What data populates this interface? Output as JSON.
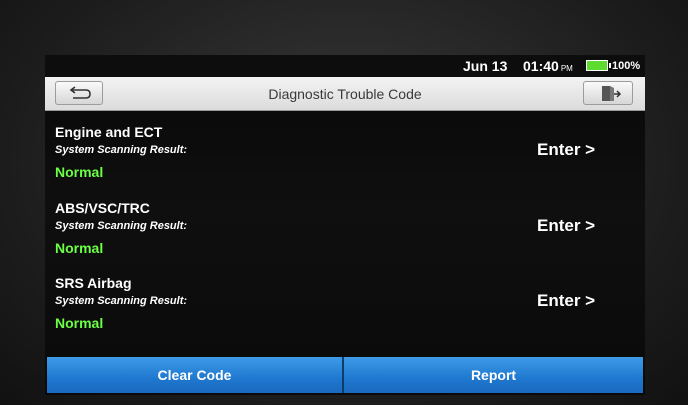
{
  "status_bar": {
    "date": "Jun 13",
    "time": "01:40",
    "ampm": "PM",
    "battery_percent": "100%",
    "battery_level": 1.0,
    "battery_color": "#5ddc2f"
  },
  "header": {
    "title": "Diagnostic Trouble Code",
    "back_icon": "back-arrow-icon",
    "exit_icon": "exit-door-icon"
  },
  "systems": [
    {
      "name": "Engine and ECT",
      "scan_label": "System Scanning Result:",
      "status": "Normal",
      "action": "Enter >"
    },
    {
      "name": "ABS/VSC/TRC",
      "scan_label": "System Scanning Result:",
      "status": "Normal",
      "action": "Enter >"
    },
    {
      "name": "SRS Airbag",
      "scan_label": "System Scanning Result:",
      "status": "Normal",
      "action": "Enter >"
    }
  ],
  "footer": {
    "clear_label": "Clear Code",
    "report_label": "Report"
  },
  "colors": {
    "status_ok": "#6bff45",
    "button_blue": "#1f78cf"
  }
}
